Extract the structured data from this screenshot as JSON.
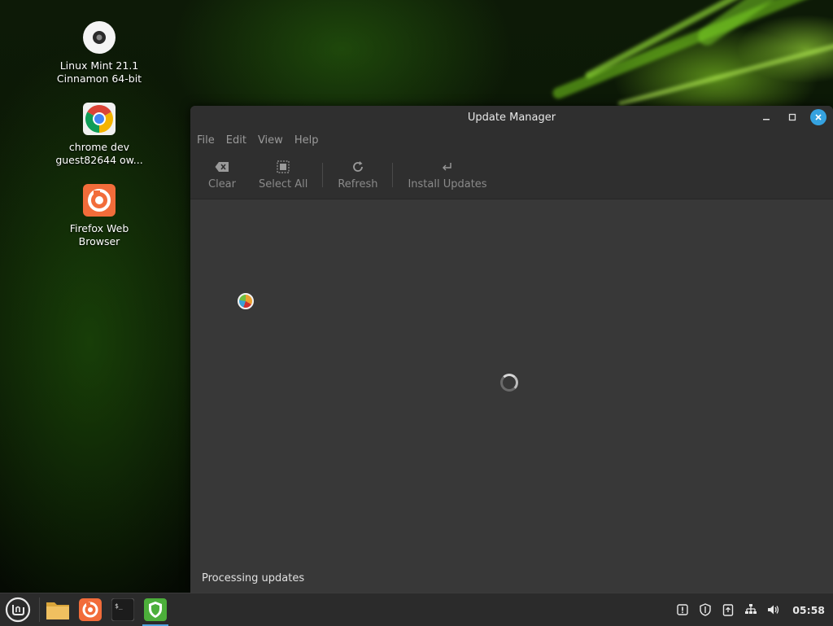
{
  "desktop": {
    "icons": [
      {
        "label_line1": "Linux Mint 21.1",
        "label_line2": "Cinnamon 64-bit",
        "icon": "disc-icon"
      },
      {
        "label_line1": "chrome dev",
        "label_line2": "guest82644 ow...",
        "icon": "chrome-icon"
      },
      {
        "label_line1": "Firefox Web",
        "label_line2": "Browser",
        "icon": "firefox-icon"
      }
    ]
  },
  "window": {
    "title": "Update Manager",
    "menu": [
      "File",
      "Edit",
      "View",
      "Help"
    ],
    "toolbar": {
      "clear": "Clear",
      "select_all": "Select All",
      "refresh": "Refresh",
      "install_updates": "Install Updates"
    },
    "status": "Processing updates"
  },
  "taskbar": {
    "apps": [
      "menu-icon",
      "files-icon",
      "firefox-icon",
      "terminal-icon",
      "update-manager-icon"
    ],
    "clock": "05:58"
  },
  "colors": {
    "accent": "#35a2e0",
    "window_bg": "#383838",
    "header_bg": "#2f2f2f",
    "mint_green": "#6fbf40"
  }
}
